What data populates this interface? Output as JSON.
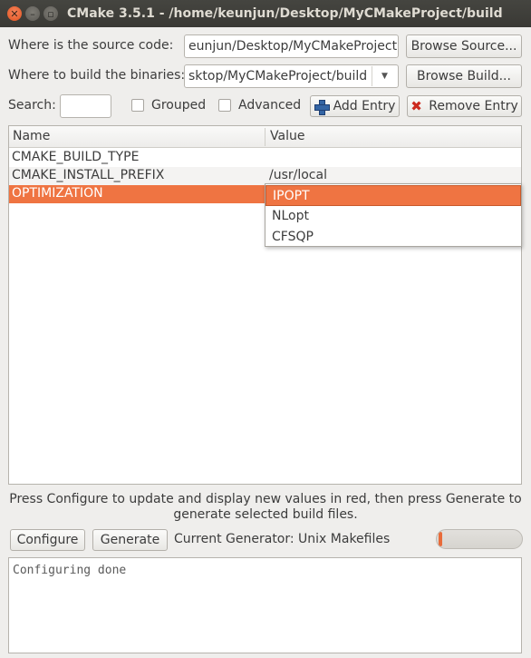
{
  "window": {
    "title": "CMake 3.5.1 - /home/keunjun/Desktop/MyCMakeProject/build"
  },
  "source": {
    "label": "Where is the source code:",
    "value": "eunjun/Desktop/MyCMakeProject",
    "browse_label": "Browse Source..."
  },
  "build": {
    "label": "Where to build the binaries:",
    "value": "sktop/MyCMakeProject/build",
    "browse_label": "Browse Build..."
  },
  "toolbar": {
    "search_label": "Search:",
    "search_value": "",
    "grouped_label": "Grouped",
    "grouped_checked": false,
    "advanced_label": "Advanced",
    "advanced_checked": false,
    "add_entry_label": "Add Entry",
    "remove_entry_label": "Remove Entry"
  },
  "table": {
    "columns": [
      "Name",
      "Value"
    ],
    "rows": [
      {
        "name": "CMAKE_BUILD_TYPE",
        "value": ""
      },
      {
        "name": "CMAKE_INSTALL_PREFIX",
        "value": "/usr/local"
      },
      {
        "name": "OPTIMIZATION",
        "value": "IPOPT"
      }
    ],
    "selected_row": 2
  },
  "dropdown": {
    "options": [
      "IPOPT",
      "NLopt",
      "CFSQP"
    ],
    "selected": "IPOPT"
  },
  "hint": "Press Configure to update and display new values in red, then press Generate to generate selected build files.",
  "actions": {
    "configure_label": "Configure",
    "generate_label": "Generate",
    "generator_text": "Current Generator: Unix Makefiles"
  },
  "progress": {
    "value": 0.03
  },
  "output": {
    "text": "Configuring done"
  },
  "colors": {
    "accent": "#ef7442",
    "selection": "#ef7442"
  }
}
